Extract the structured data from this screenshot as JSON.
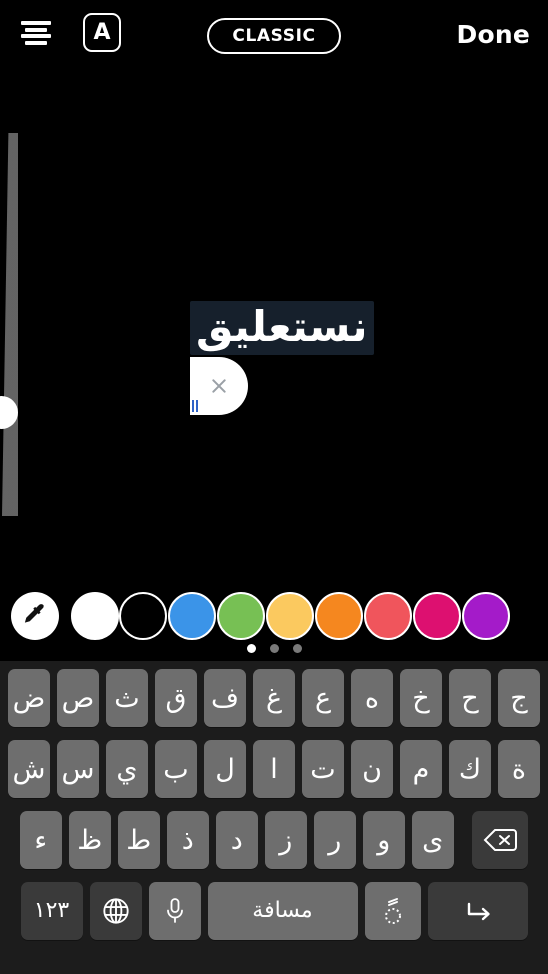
{
  "app": {
    "background_color": "#000000",
    "keyboard_bg": "#1c1c1c"
  },
  "topbar": {
    "align_icon": "text-align-center-icon",
    "bg_toggle_label": "A",
    "bg_toggle_icon": "text-background-icon",
    "font_style_label": "CLASSIC",
    "done_label": "Done"
  },
  "size_slider": {
    "name": "font-size-slider",
    "handle_position_percent": 73
  },
  "canvas": {
    "text": "نستعليق",
    "text_color": "#ffffff",
    "highlight_color": "#16202c",
    "sticker": {
      "close_icon": "close-icon",
      "color": "#ffffff",
      "accent_color": "#2f63c7"
    }
  },
  "palette": {
    "eyedropper_icon": "eyedropper-icon",
    "swatches": [
      {
        "name": "white",
        "color": "#ffffff"
      },
      {
        "name": "black",
        "color": "#000000"
      },
      {
        "name": "blue",
        "color": "#3b94e8"
      },
      {
        "name": "green",
        "color": "#77c054"
      },
      {
        "name": "yellow",
        "color": "#fbc95f"
      },
      {
        "name": "orange",
        "color": "#f5871f"
      },
      {
        "name": "red",
        "color": "#f0555c"
      },
      {
        "name": "pink",
        "color": "#dd1070"
      },
      {
        "name": "purple",
        "color": "#a41bc9"
      }
    ],
    "page_dots": {
      "count": 3,
      "active_index": 0
    }
  },
  "keyboard": {
    "language": "arabic",
    "row1": [
      "ض",
      "ص",
      "ث",
      "ق",
      "ف",
      "غ",
      "ع",
      "ه",
      "خ",
      "ح",
      "ج"
    ],
    "row2": [
      "ش",
      "س",
      "ي",
      "ب",
      "ل",
      "ا",
      "ت",
      "ن",
      "م",
      "ك",
      "ة"
    ],
    "row3": [
      "ء",
      "ظ",
      "ط",
      "ذ",
      "د",
      "ز",
      "ر",
      "و",
      "ى"
    ],
    "backspace_icon": "backspace-icon",
    "bottom": {
      "numbers_label": "١٢٣",
      "globe_icon": "globe-icon",
      "mic_icon": "microphone-icon",
      "space_label": "مسافة",
      "harakat_icon": "harakat-icon",
      "return_icon": "return-icon"
    }
  }
}
